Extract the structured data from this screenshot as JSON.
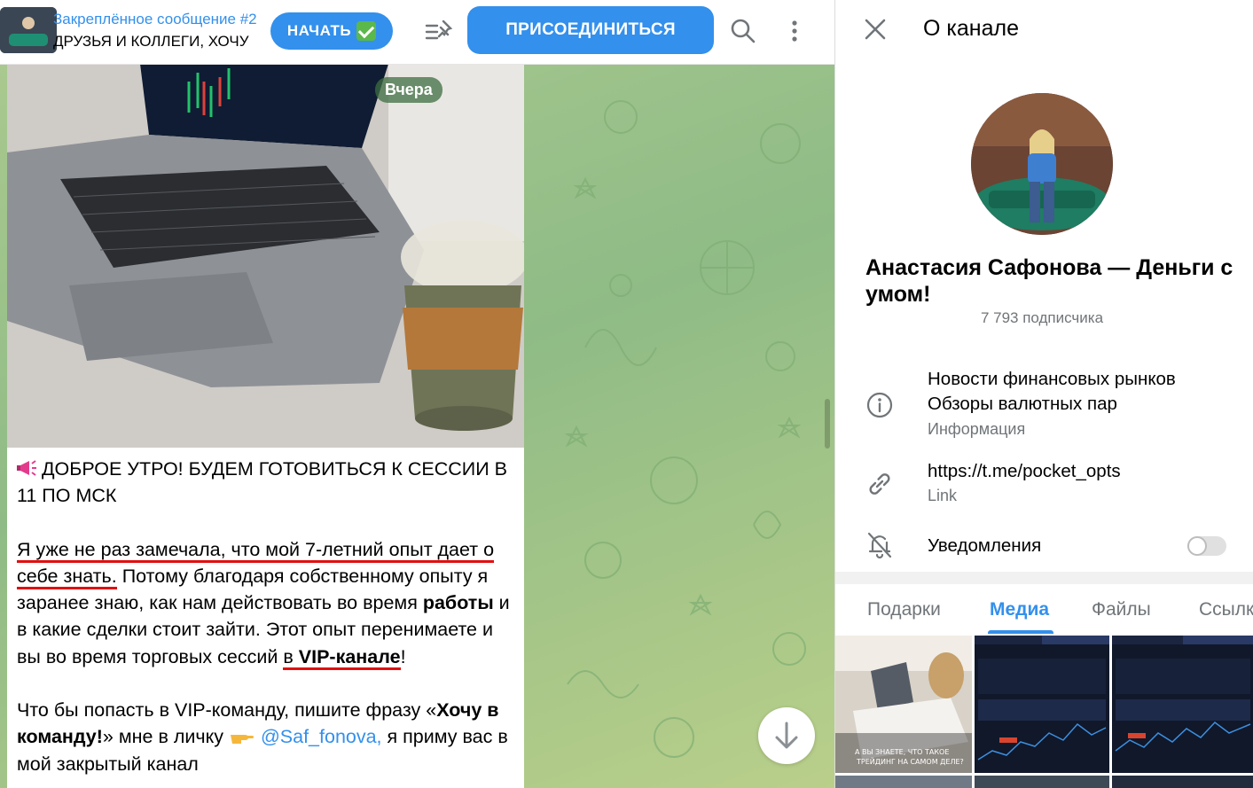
{
  "header": {
    "pinned_title": "Закреплённое сообщение #2",
    "pinned_text": "ДРУЗЬЯ И КОЛЛЕГИ, ХОЧУ",
    "start_button": "НАЧАТЬ",
    "join_button": "ПРИСОЕДИНИТЬСЯ"
  },
  "message": {
    "date_badge": "Вчера",
    "p1_line": "ДОБРОЕ УТРО! БУДЕМ ГОТОВИТЬСЯ К СЕССИИ В 11 ПО МСК",
    "p2_highlight": "Я уже не раз замечала, что мой 7-летний опыт дает о себе знать.",
    "p2_text_a": " Потому благодаря собственному опыту я заранее знаю, как нам действовать во время ",
    "p2_bold_a": "работы",
    "p2_text_b": " и в какие сделки стоит зайти. Этот опыт перенимаете и вы во время торговых сессий ",
    "p2_vip_prefix": "в ",
    "p2_vip_bold": "VIP-канале",
    "p2_end": "!",
    "p3_text_a": "Что бы попасть в VIP-команду, пишите фразу «",
    "p3_bold": "Хочу в команду!",
    "p3_text_b": "» мне в личку ",
    "p3_mention": "@Saf_fonova,",
    "p3_text_c": " я приму вас в мой закрытый канал"
  },
  "panel": {
    "title": "О канале",
    "channel_name": "Анастасия Сафонова — Деньги с умом!",
    "subscribers": "7 793 подписчика",
    "description_line1": "Новости финансовых рынков",
    "description_line2": "Обзоры валютных пар",
    "description_label": "Информация",
    "link": "https://t.me/pocket_opts",
    "link_label": "Link",
    "notifications_label": "Уведомления",
    "notifications_on": false,
    "tabs": [
      "Подарки",
      "Медиа",
      "Файлы",
      "Ссылки"
    ],
    "active_tab": "Медиа",
    "media_caption": "А ВЫ ЗНАЕТЕ, ЧТО ТАКОЕ ТРЕЙДИНГ НА САМОМ ДЕЛЕ?"
  },
  "colors": {
    "accent": "#3390ec",
    "underline_red": "#e01111",
    "chat_bg": "#9ec38a"
  },
  "icons": [
    "check-emoji-icon",
    "pinned-list-icon",
    "search-icon",
    "more-vertical-icon",
    "megaphone-emoji-icon",
    "pointing-hand-emoji-icon",
    "arrow-down-icon",
    "close-icon",
    "info-icon",
    "link-icon",
    "bell-off-icon"
  ]
}
